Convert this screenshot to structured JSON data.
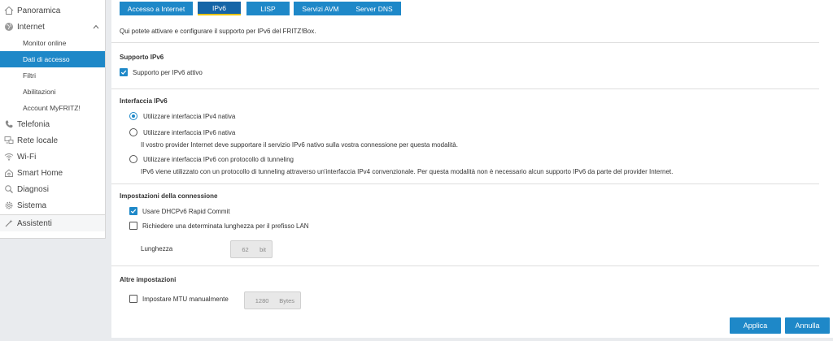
{
  "sidebar": {
    "items": [
      {
        "label": "Panoramica",
        "icon": "home-icon"
      },
      {
        "label": "Internet",
        "icon": "globe-icon",
        "expanded": true
      },
      {
        "label": "Telefonia",
        "icon": "phone-icon"
      },
      {
        "label": "Rete locale",
        "icon": "network-icon"
      },
      {
        "label": "Wi-Fi",
        "icon": "wifi-icon"
      },
      {
        "label": "Smart Home",
        "icon": "smart-home-icon"
      },
      {
        "label": "Diagnosi",
        "icon": "search-icon"
      },
      {
        "label": "Sistema",
        "icon": "gear-icon"
      },
      {
        "label": "Assistenti",
        "icon": "wizard-icon"
      }
    ],
    "internet_sub": [
      {
        "label": "Monitor online",
        "active": false
      },
      {
        "label": "Dati di accesso",
        "active": true
      },
      {
        "label": "Filtri",
        "active": false
      },
      {
        "label": "Abilitazioni",
        "active": false
      },
      {
        "label": "Account MyFRITZ!",
        "active": false
      }
    ]
  },
  "tabs": [
    {
      "label": "Accesso a Internet",
      "active": false
    },
    {
      "label": "IPv6",
      "active": true
    },
    {
      "label": "LISP",
      "active": false
    },
    {
      "label": "Servizi AVM",
      "active": false
    },
    {
      "label": "Server DNS",
      "active": false
    }
  ],
  "intro": "Qui potete attivare e configurare il supporto per IPv6 del FRITZ!Box.",
  "support": {
    "title": "Supporto IPv6",
    "checkbox_label": "Supporto per IPv6 attivo",
    "checked": true
  },
  "interface": {
    "title": "Interfaccia IPv6",
    "options": [
      {
        "label": "Utilizzare interfaccia IPv4 nativa",
        "selected": true,
        "description": ""
      },
      {
        "label": "Utilizzare interfaccia IPv6 nativa",
        "selected": false,
        "description": "Il vostro provider Internet deve supportare il servizio IPv6 nativo sulla vostra connessione per questa modalità."
      },
      {
        "label": "Utilizzare interfaccia IPv6 con protocollo di tunneling",
        "selected": false,
        "description": "IPv6 viene utilizzato con un protocollo di tunneling attraverso un'interfaccia IPv4 convenzionale. Per questa modalità non è necessario alcun supporto IPv6 da parte del provider Internet."
      }
    ]
  },
  "connection": {
    "title": "Impostazioni della connessione",
    "dhcp_label": "Usare DHCPv6 Rapid Commit",
    "dhcp_checked": true,
    "prefix_label": "Richiedere una determinata lunghezza per il prefisso LAN",
    "prefix_checked": false,
    "length_label": "Lunghezza",
    "length_value": "62",
    "length_unit": "bit"
  },
  "other": {
    "title": "Altre impostazioni",
    "mtu_label": "Impostare MTU manualmente",
    "mtu_checked": false,
    "mtu_value": "1280",
    "mtu_unit": "Bytes"
  },
  "buttons": {
    "apply": "Applica",
    "cancel": "Annulla"
  },
  "colors": {
    "accent": "#1e88c8",
    "tab_active": "#1565a7",
    "tab_indicator": "#e8c300"
  }
}
